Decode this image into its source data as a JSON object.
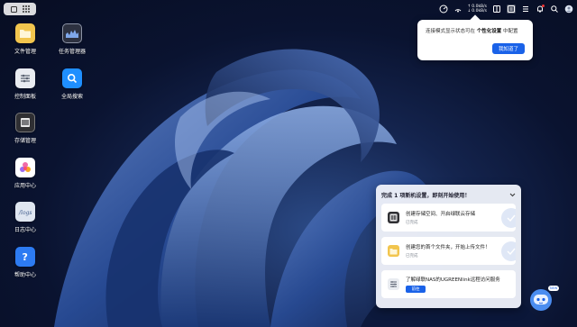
{
  "taskbar": {
    "upload_speed": "0.0kB/s",
    "download_speed": "0.0kB/s"
  },
  "desktop": {
    "icons": [
      {
        "label": "文件管理",
        "icon": "folder-icon",
        "color": "#f2c54e"
      },
      {
        "label": "任务管理器",
        "icon": "activity-monitor-icon",
        "color": "#2d3140"
      },
      {
        "label": "控制面板",
        "icon": "sliders-icon",
        "color": "#e9ecf1"
      },
      {
        "label": "全局搜索",
        "icon": "search-icon",
        "color": "#1f8fff"
      },
      {
        "label": "存储管理",
        "icon": "disk-array-icon",
        "color": "#2f2f33"
      },
      {
        "label": "应用中心",
        "icon": "app-store-icon",
        "color": "#ffffff"
      },
      {
        "label": "日志中心",
        "icon": "logs-icon",
        "color": "#dfe6f1"
      },
      {
        "label": "帮助中心",
        "icon": "help-icon",
        "color": "#2d7bf2"
      }
    ]
  },
  "tooltip": {
    "text_prefix": "连接模式显示状态可在",
    "text_bold": "个性化设置",
    "text_suffix": "中配置",
    "button": "我知道了"
  },
  "setup_panel": {
    "title": "完成 1 项新机设置，即刻开始使用！",
    "cards": [
      {
        "title": "创建存储空间、开启绿联云存储",
        "status": "已完成",
        "icon": "storage-icon"
      },
      {
        "title": "创建您的首个文件夹，开始上传文件！",
        "status": "已完成",
        "icon": "folder-icon"
      },
      {
        "title": "了解绿联NAS的UGREENlink远程访问服务",
        "button": "前往",
        "icon": "remote-link-icon"
      }
    ]
  },
  "assistant": {
    "badge": "NEW"
  },
  "colors": {
    "accent": "#1a62e8",
    "wallpaper_dark": "#0a1330",
    "wallpaper_light": "#2b4a86"
  }
}
